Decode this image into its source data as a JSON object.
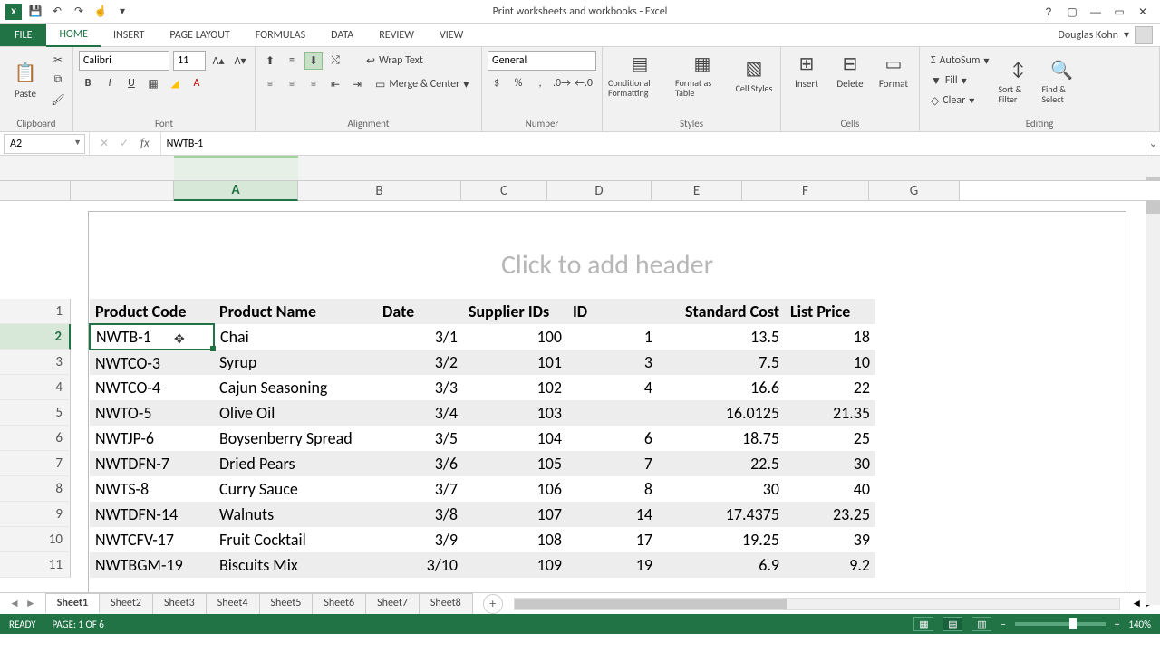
{
  "window": {
    "title": "Print worksheets and workbooks - Excel"
  },
  "account": {
    "name": "Douglas Kohn"
  },
  "ribbon": {
    "file": "FILE",
    "tabs": [
      "HOME",
      "INSERT",
      "PAGE LAYOUT",
      "FORMULAS",
      "DATA",
      "REVIEW",
      "VIEW"
    ],
    "groups": {
      "clipboard": {
        "label": "Clipboard",
        "paste": "Paste"
      },
      "font": {
        "label": "Font",
        "name": "Calibri",
        "size": "11"
      },
      "alignment": {
        "label": "Alignment",
        "wrap": "Wrap Text",
        "merge": "Merge & Center"
      },
      "number": {
        "label": "Number",
        "format": "General"
      },
      "styles": {
        "label": "Styles",
        "cf": "Conditional Formatting",
        "fat": "Format as Table",
        "cs": "Cell Styles"
      },
      "cells": {
        "label": "Cells",
        "insert": "Insert",
        "delete": "Delete",
        "format": "Format"
      },
      "editing": {
        "label": "Editing",
        "autosum": "AutoSum",
        "fill": "Fill",
        "clear": "Clear",
        "sort": "Sort & Filter",
        "find": "Find & Select"
      }
    }
  },
  "formula_bar": {
    "namebox": "A2",
    "formula": "NWTB-1"
  },
  "sheet": {
    "header_placeholder": "Click to add header",
    "columns": [
      "A",
      "B",
      "C",
      "D",
      "E",
      "F",
      "G"
    ],
    "headers": [
      "Product Code",
      "Product Name",
      "Date",
      "Supplier IDs",
      "ID",
      "Standard Cost",
      "List Price"
    ],
    "rows": [
      {
        "n": "1"
      },
      {
        "n": "2",
        "sel": true
      },
      {
        "n": "3"
      },
      {
        "n": "4"
      },
      {
        "n": "5"
      },
      {
        "n": "6"
      },
      {
        "n": "7"
      },
      {
        "n": "8"
      },
      {
        "n": "9"
      },
      {
        "n": "10"
      },
      {
        "n": "11"
      }
    ],
    "data": [
      [
        "NWTB-1",
        "Chai",
        "3/1",
        "100",
        "1",
        "13.5",
        "18"
      ],
      [
        "NWTCO-3",
        "Syrup",
        "3/2",
        "101",
        "3",
        "7.5",
        "10"
      ],
      [
        "NWTCO-4",
        "Cajun Seasoning",
        "3/3",
        "102",
        "4",
        "16.6",
        "22"
      ],
      [
        "NWTO-5",
        "Olive Oil",
        "3/4",
        "103",
        "",
        "16.0125",
        "21.35"
      ],
      [
        "NWTJP-6",
        "Boysenberry Spread",
        "3/5",
        "104",
        "6",
        "18.75",
        "25"
      ],
      [
        "NWTDFN-7",
        "Dried Pears",
        "3/6",
        "105",
        "7",
        "22.5",
        "30"
      ],
      [
        "NWTS-8",
        "Curry Sauce",
        "3/7",
        "106",
        "8",
        "30",
        "40"
      ],
      [
        "NWTDFN-14",
        "Walnuts",
        "3/8",
        "107",
        "14",
        "17.4375",
        "23.25"
      ],
      [
        "NWTCFV-17",
        "Fruit Cocktail",
        "3/9",
        "108",
        "17",
        "19.25",
        "39"
      ],
      [
        "NWTBGM-19",
        "Biscuits Mix",
        "3/10",
        "109",
        "19",
        "6.9",
        "9.2"
      ]
    ]
  },
  "sheet_tabs": [
    "Sheet1",
    "Sheet2",
    "Sheet3",
    "Sheet4",
    "Sheet5",
    "Sheet6",
    "Sheet7",
    "Sheet8"
  ],
  "status": {
    "ready": "READY",
    "page": "PAGE: 1 OF 6",
    "zoom": "140%"
  },
  "chart_data": {
    "type": "table",
    "title": "Print worksheets and workbooks",
    "columns": [
      "Product Code",
      "Product Name",
      "Date",
      "Supplier IDs",
      "ID",
      "Standard Cost",
      "List Price"
    ],
    "rows": [
      [
        "NWTB-1",
        "Chai",
        "3/1",
        100,
        1,
        13.5,
        18
      ],
      [
        "NWTCO-3",
        "Syrup",
        "3/2",
        101,
        3,
        7.5,
        10
      ],
      [
        "NWTCO-4",
        "Cajun Seasoning",
        "3/3",
        102,
        4,
        16.6,
        22
      ],
      [
        "NWTO-5",
        "Olive Oil",
        "3/4",
        103,
        null,
        16.0125,
        21.35
      ],
      [
        "NWTJP-6",
        "Boysenberry Spread",
        "3/5",
        104,
        6,
        18.75,
        25
      ],
      [
        "NWTDFN-7",
        "Dried Pears",
        "3/6",
        105,
        7,
        22.5,
        30
      ],
      [
        "NWTS-8",
        "Curry Sauce",
        "3/7",
        106,
        8,
        30,
        40
      ],
      [
        "NWTDFN-14",
        "Walnuts",
        "3/8",
        107,
        14,
        17.4375,
        23.25
      ],
      [
        "NWTCFV-17",
        "Fruit Cocktail",
        "3/9",
        108,
        17,
        19.25,
        39
      ],
      [
        "NWTBGM-19",
        "Biscuits Mix",
        "3/10",
        109,
        19,
        6.9,
        9.2
      ]
    ]
  }
}
